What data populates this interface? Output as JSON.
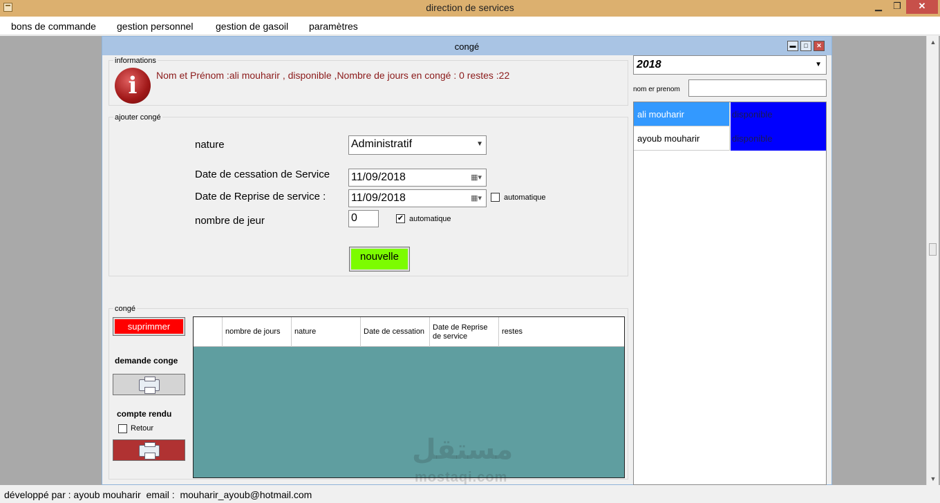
{
  "window": {
    "title": "direction de services",
    "min_glyph": "▁",
    "max_glyph": "❐",
    "close_glyph": "✕"
  },
  "menu": [
    "bons de commande",
    "gestion personnel",
    "gestion de gasoil",
    "paramètres"
  ],
  "child_window": {
    "title": "congé",
    "min_glyph": "▬",
    "max_glyph": "□",
    "close_glyph": "✕"
  },
  "informations": {
    "legend": "informations",
    "icon_glyph": "i",
    "text": "Nom et Prénom :ali  mouharir , disponible ,Nombre de jours en congé : 0 restes :22"
  },
  "ajouter_conge": {
    "legend": "ajouter congé",
    "nature_label": "nature",
    "nature_value": "Administratif",
    "cessation_label": "Date de cessation de Service",
    "cessation_value": "11/09/2018",
    "reprise_label": "Date de Reprise de service :",
    "reprise_value": "11/09/2018",
    "reprise_auto_label": "automatique",
    "reprise_auto_checked": false,
    "nb_jours_label": "nombre de jeur",
    "nb_jours_value": "0",
    "nb_auto_label": "automatique",
    "nb_auto_checked": true,
    "nouvelle_label": "nouvelle"
  },
  "conge_group": {
    "legend": "congé",
    "supprimer_label": "suprimmer",
    "demande_label": "demande conge",
    "compte_rendu_label": "compte rendu",
    "retour_label": "Retour",
    "retour_checked": false
  },
  "grid": {
    "columns": [
      "nombre de jours",
      "nature",
      "Date de cessation",
      "Date de Reprise de service",
      "restes"
    ]
  },
  "right_panel": {
    "year": "2018",
    "search_label": "nom er prenom",
    "search_value": "",
    "employees": [
      {
        "name": "ali  mouharir",
        "status": "disponible",
        "selected": true
      },
      {
        "name": "ayoub mouharir",
        "status": "disponible",
        "selected": false
      }
    ]
  },
  "colors": {
    "title_bar": "#dcb06f",
    "child_title": "#a9c4e4",
    "info_text": "#8b1a1a",
    "nouvelle": "#7cfc00",
    "supprimer": "#ff0000",
    "grid_bg": "#5f9ea0",
    "status_cell": "#0000ff",
    "selection": "#3399ff"
  },
  "watermark": {
    "arabic": "مستقل",
    "latin": "mostaqi.com"
  },
  "status_bar": "développé par : ayoub mouharir  email :  mouharir_ayoub@hotmail.com"
}
